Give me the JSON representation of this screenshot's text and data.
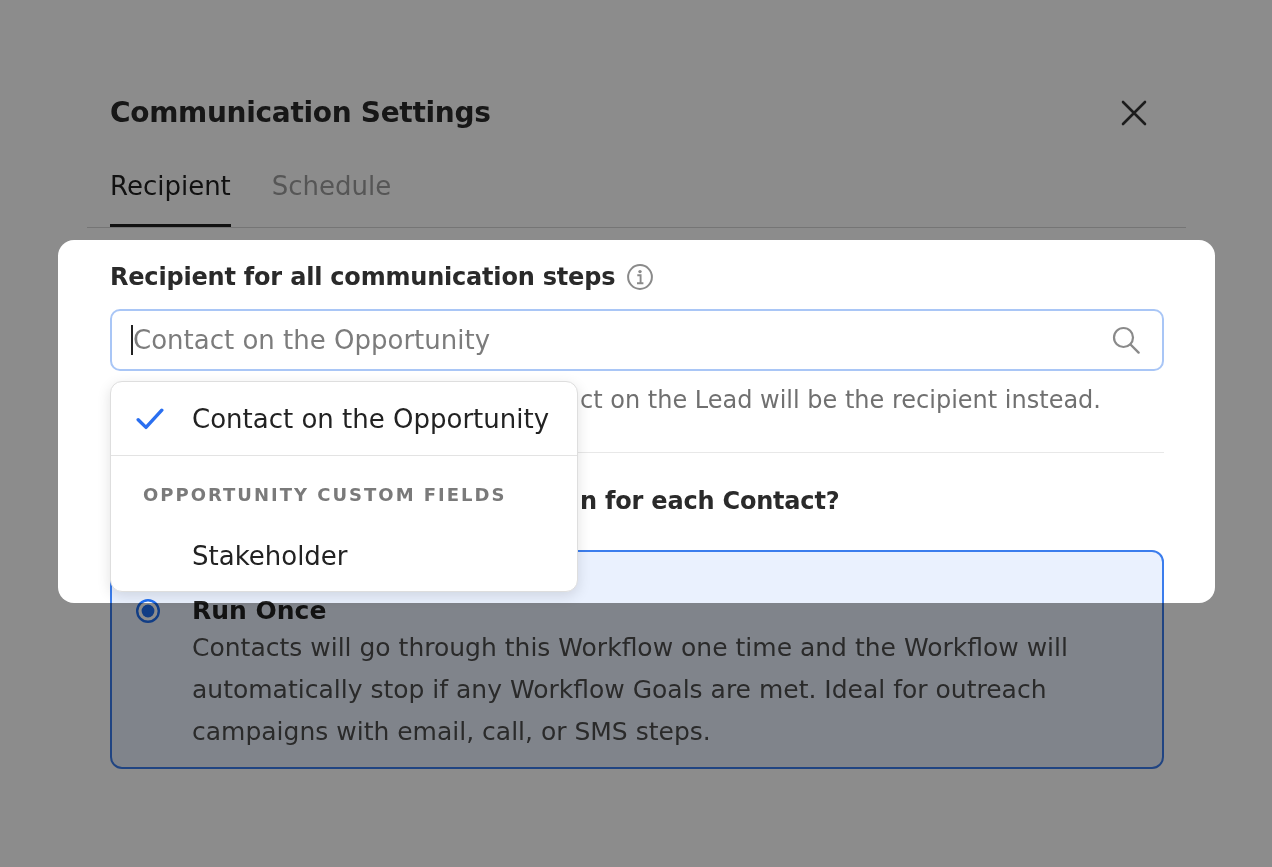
{
  "dialog": {
    "title": "Communication Settings"
  },
  "tabs": [
    {
      "label": "Recipient",
      "selected": true
    },
    {
      "label": "Schedule",
      "selected": false
    }
  ],
  "recipient": {
    "heading": "Recipient for all communication steps",
    "search": {
      "placeholder": "Contact on the Opportunity",
      "focused": true
    },
    "helper_text": "ct on the Lead will be the recipient instead.",
    "dropdown": {
      "options": [
        {
          "label": "Contact on the Opportunity",
          "selected": true
        }
      ],
      "groups": [
        {
          "header": "OPPORTUNITY CUSTOM FIELDS",
          "options": [
            {
              "label": "Stakeholder",
              "selected": false
            }
          ]
        }
      ]
    }
  },
  "run_mode": {
    "question": "n for each Contact?",
    "options": [
      {
        "title": "Run Once",
        "description": "Contacts will go through this Workflow one time and the Workflow will automatically stop if any Workflow Goals are met. Ideal for outreach campaigns with email, call, or SMS steps.",
        "selected": true
      }
    ]
  }
}
